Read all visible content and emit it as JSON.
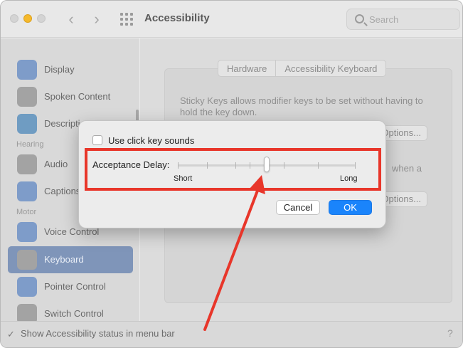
{
  "window": {
    "title": "Accessibility",
    "search_placeholder": "Search"
  },
  "sidebar": {
    "items": [
      {
        "label": "Display",
        "icon": "display-icon"
      },
      {
        "label": "Spoken Content",
        "icon": "speech-bubble-icon"
      },
      {
        "label": "Descriptions",
        "icon": "descriptions-icon"
      },
      {
        "label": "Audio",
        "icon": "speaker-icon"
      },
      {
        "label": "Captions",
        "icon": "captions-icon"
      },
      {
        "label": "Voice Control",
        "icon": "voice-control-icon"
      },
      {
        "label": "Keyboard",
        "icon": "keyboard-icon",
        "selected": true
      },
      {
        "label": "Pointer Control",
        "icon": "pointer-icon"
      },
      {
        "label": "Switch Control",
        "icon": "switch-control-icon"
      }
    ],
    "headers": {
      "hearing": "Hearing",
      "motor": "Motor"
    }
  },
  "content": {
    "tabs": [
      "Hardware",
      "Accessibility Keyboard"
    ],
    "sticky_keys_text": "Sticky Keys allows modifier keys to be set without having to hold the key down.",
    "options_label": "Options...",
    "fragment_text": "when a"
  },
  "dialog": {
    "checkbox_label": "Use click key sounds",
    "checkbox_checked": false,
    "delay_label": "Acceptance Delay:",
    "slider_min_label": "Short",
    "slider_max_label": "Long",
    "slider_value_fraction": 0.5,
    "cancel_label": "Cancel",
    "ok_label": "OK"
  },
  "bottom_bar": {
    "checkbox_label": "Show Accessibility status in menu bar",
    "checkbox_checked": true,
    "help_label": "?"
  },
  "colors": {
    "accent": "#1a84fb",
    "annotation": "#e8362a",
    "sidebar_selected": "#7f95b9"
  }
}
